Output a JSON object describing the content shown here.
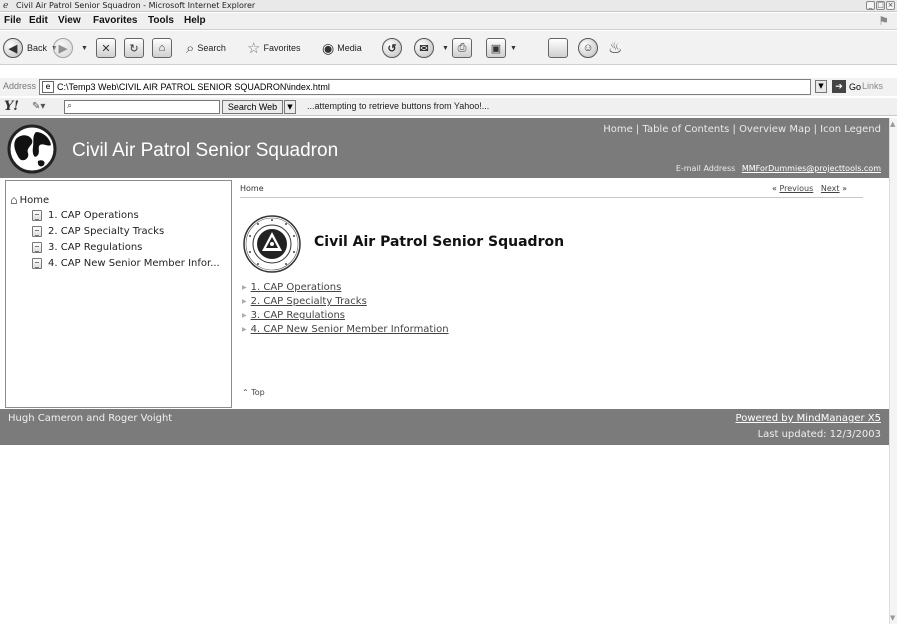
{
  "window": {
    "title": "Civil Air Patrol Senior Squadron - Microsoft Internet Explorer"
  },
  "menu": [
    "File",
    "Edit",
    "View",
    "Favorites",
    "Tools",
    "Help"
  ],
  "toolbar": {
    "back": "Back",
    "search": "Search",
    "favorites": "Favorites",
    "media": "Media"
  },
  "address": {
    "label": "Address",
    "url": "C:\\Temp3 Web\\CIVIL AIR PATROL SENIOR SQUADRON\\index.html",
    "go": "Go",
    "links": "Links"
  },
  "yahoo": {
    "search_button": "Search Web",
    "status": "...attempting to retrieve buttons from Yahoo!..."
  },
  "site": {
    "title": "Civil Air Patrol Senior Squadron",
    "toplinks": [
      "Home",
      "Table of Contents",
      "Overview Map",
      "Icon Legend"
    ],
    "email_label": "E-mail Address",
    "email": "MMForDummies@projecttools.com"
  },
  "nav": {
    "home": "Home",
    "items": [
      "1. CAP Operations",
      "2. CAP Specialty Tracks",
      "3. CAP Regulations",
      "4. CAP New Senior Member Infor..."
    ]
  },
  "main": {
    "breadcrumb": "Home",
    "previous": "Previous",
    "next": "Next",
    "page_title": "Civil Air Patrol Senior Squadron",
    "links": [
      "1. CAP Operations",
      "2. CAP Specialty Tracks",
      "3. CAP Regulations",
      "4. CAP New Senior Member Information"
    ],
    "top": "Top"
  },
  "footer": {
    "authors": "Hugh Cameron and Roger Voight",
    "powered": "Powered by MindManager X5",
    "updated": "Last updated: 12/3/2003"
  }
}
